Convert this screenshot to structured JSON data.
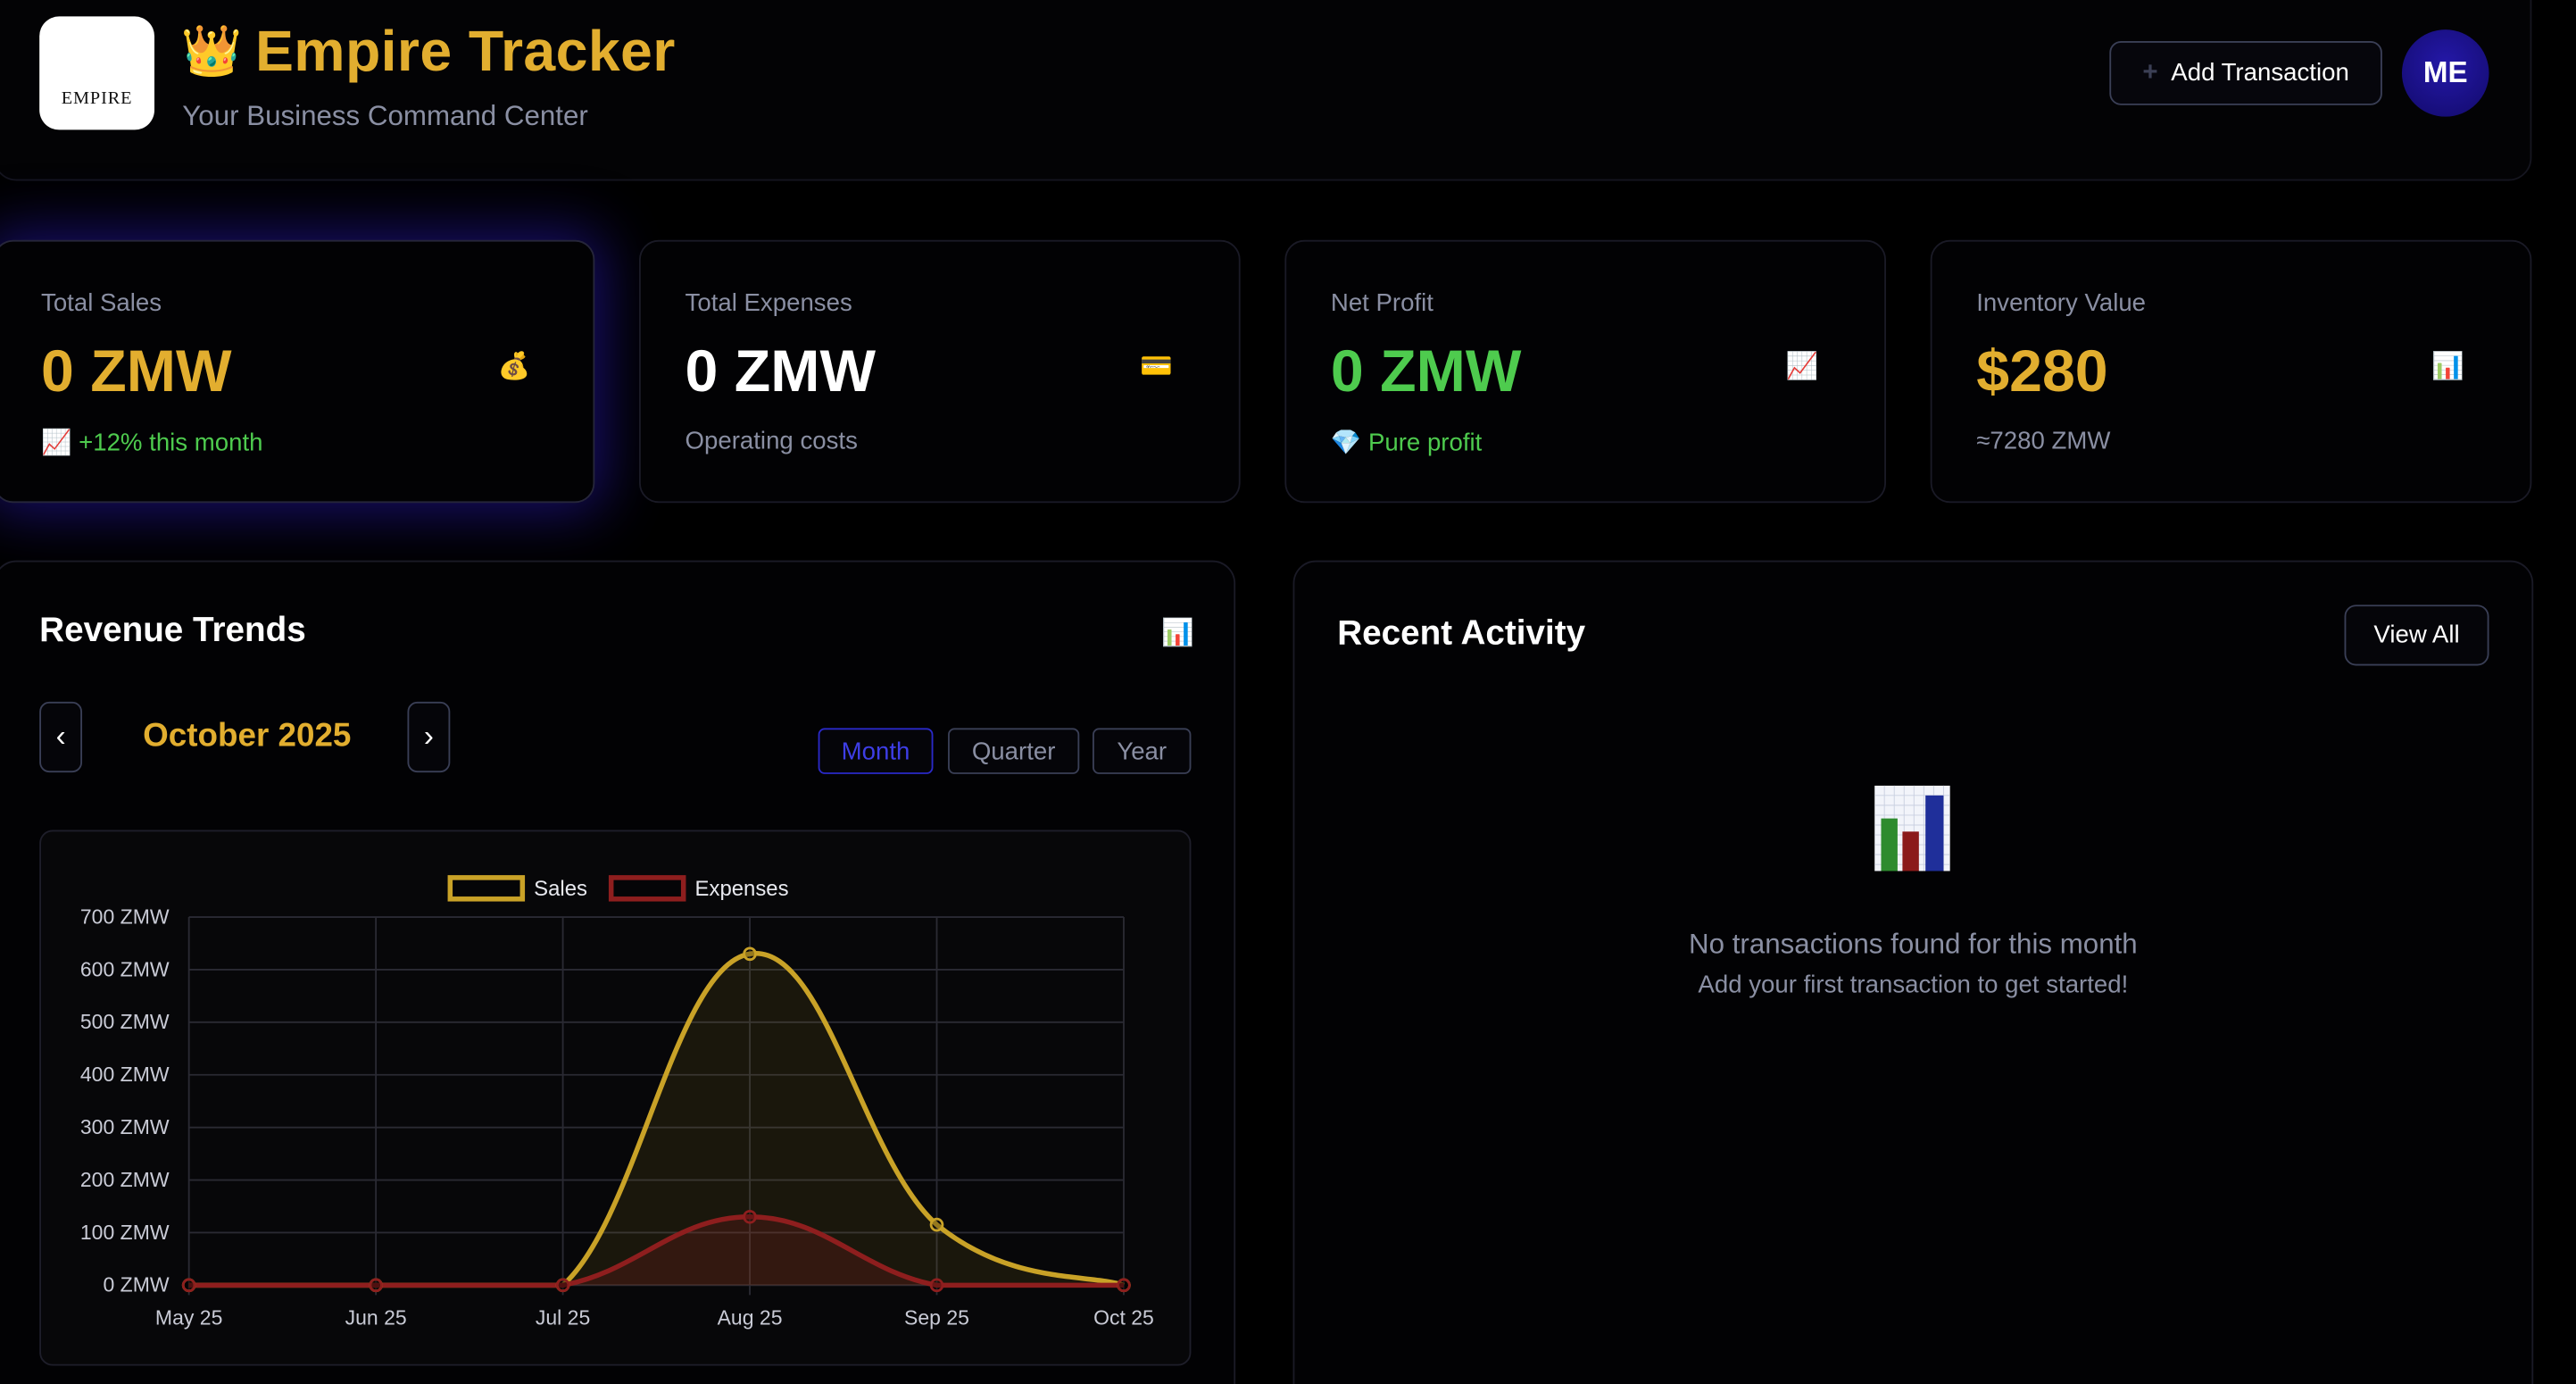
{
  "header": {
    "logo_text": "EMPIRE",
    "logo_icon": "crown-icon",
    "title_icon": "crown-emoji-icon",
    "title": "Empire Tracker",
    "subtitle": "Your Business Command Center",
    "add_button_icon": "plus-icon",
    "add_button_label": "Add Transaction",
    "avatar_initials": "ME"
  },
  "stats": [
    {
      "label": "Total Sales",
      "value": "0 ZMW",
      "sub": "+12% this month",
      "sub_icon": "chart-up-icon",
      "icon": "money-bag-icon",
      "value_color": "#e2ae2f",
      "sub_color": "#4ecb4e"
    },
    {
      "label": "Total Expenses",
      "value": "0 ZMW",
      "sub": "Operating costs",
      "icon": "credit-card-icon",
      "value_color": "#ffffff",
      "sub_color": "#8a8fa3"
    },
    {
      "label": "Net Profit",
      "value": "0 ZMW",
      "sub": "Pure profit",
      "sub_icon": "gem-icon",
      "icon": "chart-up-icon",
      "value_color": "#4ecb4e",
      "sub_color": "#4ecb4e"
    },
    {
      "label": "Inventory Value",
      "value": "$280",
      "sub": "≈7280 ZMW",
      "icon": "bar-chart-icon",
      "value_color": "#e2ae2f",
      "sub_color": "#8a8fa3"
    }
  ],
  "revenue": {
    "title": "Revenue Trends",
    "title_icon": "bar-chart-icon",
    "prev_label": "‹",
    "next_label": "›",
    "period_label": "October 2025",
    "ranges": [
      "Month",
      "Quarter",
      "Year"
    ],
    "active_range": "Month"
  },
  "chart_data": {
    "type": "line",
    "x": [
      "May 25",
      "Jun 25",
      "Jul 25",
      "Aug 25",
      "Sep 25",
      "Oct 25"
    ],
    "series": [
      {
        "name": "Sales",
        "values": [
          0,
          0,
          0,
          630,
          115,
          0
        ],
        "color": "#c9a227"
      },
      {
        "name": "Expenses",
        "values": [
          0,
          0,
          0,
          130,
          0,
          0
        ],
        "color": "#8e1e1e"
      }
    ],
    "yticks": [
      "0 ZMW",
      "100 ZMW",
      "200 ZMW",
      "300 ZMW",
      "400 ZMW",
      "500 ZMW",
      "600 ZMW",
      "700 ZMW"
    ],
    "ylim": [
      0,
      700
    ],
    "legend": "top",
    "grid": true,
    "smooth": true,
    "filled": true
  },
  "activity": {
    "title": "Recent Activity",
    "view_all_label": "View All",
    "empty_icon": "bar-chart-icon",
    "empty_title": "No transactions found for this month",
    "empty_sub": "Add your first transaction to get started!"
  }
}
